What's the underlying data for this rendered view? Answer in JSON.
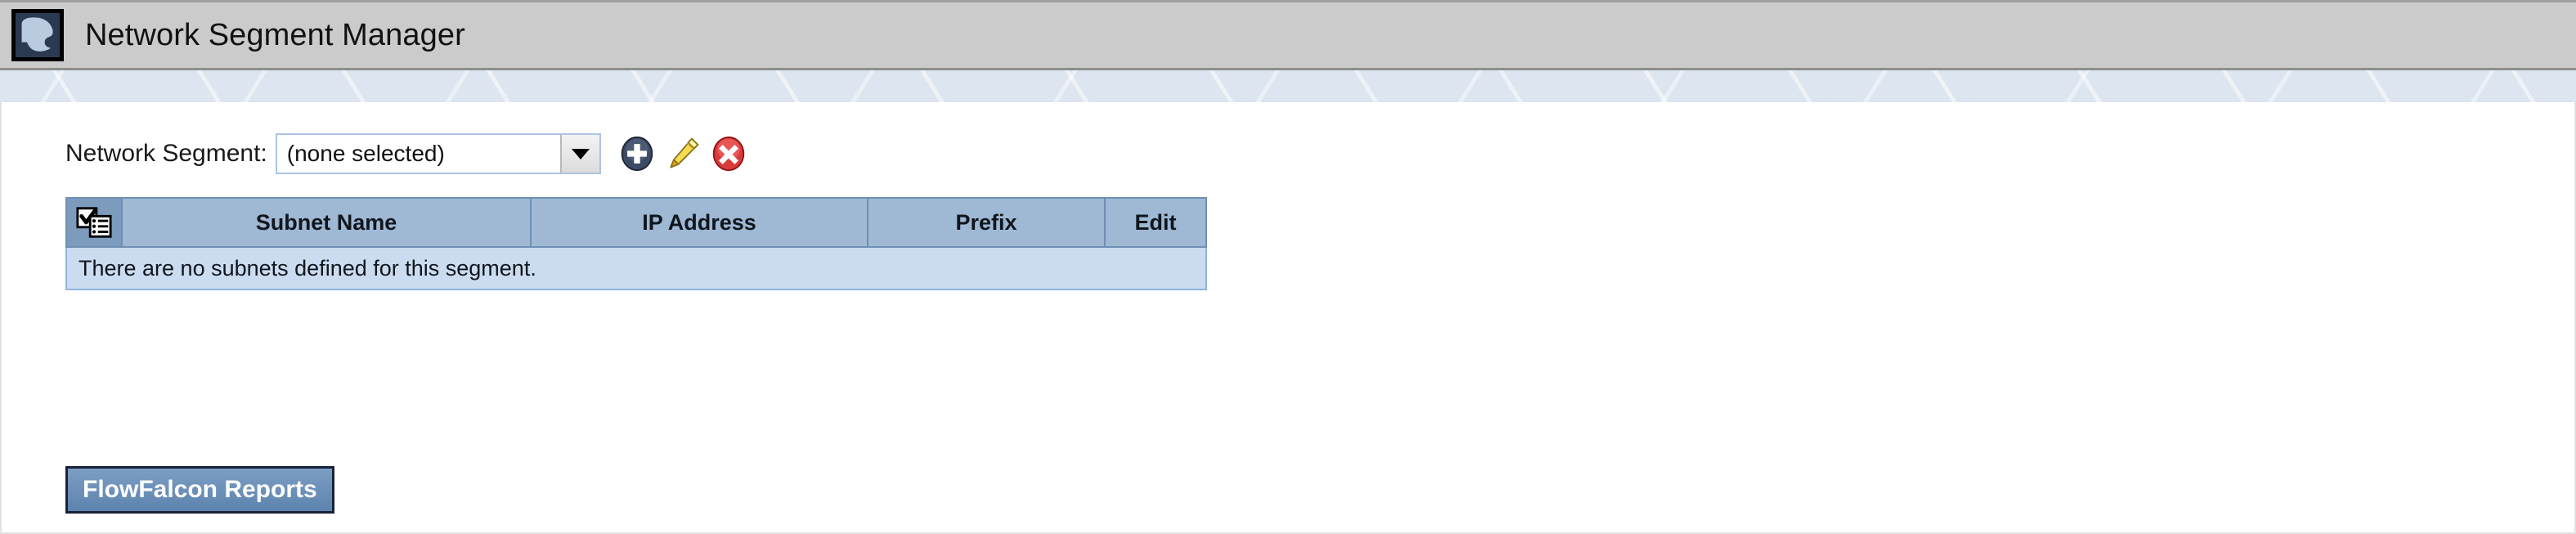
{
  "titlebar": {
    "app_icon_name": "falcon-head-icon",
    "title": "Network Segment Manager"
  },
  "segment_selector": {
    "label": "Network Segment:",
    "combo_value": "(none selected)",
    "combo_placeholder": "(none selected)",
    "dropdown_icon": "chevron-down-icon",
    "actions": [
      {
        "name": "add-segment-button",
        "icon": "plus-circle-icon",
        "title": "Add",
        "color": "#3d4a63"
      },
      {
        "name": "edit-segment-button",
        "icon": "pencil-icon",
        "title": "Edit",
        "color": "#f4dd52"
      },
      {
        "name": "delete-segment-button",
        "icon": "delete-circle-icon",
        "title": "Delete",
        "color": "#d93a3a"
      }
    ]
  },
  "subnet_table": {
    "column_selector_icon": "column-chooser-icon",
    "columns": [
      {
        "key": "subnet_name",
        "label": "Subnet Name"
      },
      {
        "key": "ip_address",
        "label": "IP Address"
      },
      {
        "key": "prefix",
        "label": "Prefix"
      },
      {
        "key": "edit",
        "label": "Edit"
      }
    ],
    "rows": [],
    "empty_message": "There are no subnets defined for this segment."
  },
  "footer": {
    "reports_button": "FlowFalcon Reports"
  },
  "colors": {
    "titlebar_bg": "#cbcbcb",
    "banner_bg": "#dce5f0",
    "table_header_bg": "#9fb8d4",
    "table_empty_bg": "#ccdcf0",
    "button_blue": "#5d83ae",
    "icon_navy": "#2b3a50"
  }
}
